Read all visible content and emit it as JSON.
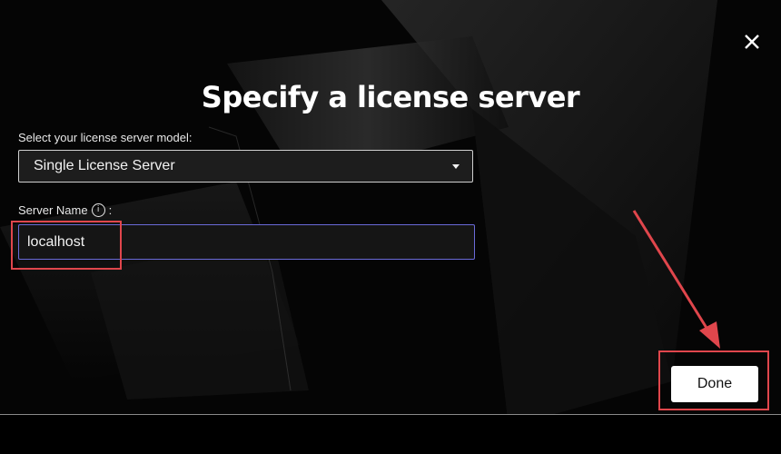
{
  "dialog": {
    "title": "Specify a license server",
    "close_icon": "close-icon"
  },
  "form": {
    "model_label": "Select your license server model:",
    "model_selected": "Single License Server",
    "server_name_label": "Server Name",
    "server_name_suffix": ":",
    "info_icon_glyph": "i",
    "server_name_value": "localhost"
  },
  "actions": {
    "done_label": "Done"
  },
  "colors": {
    "highlight": "#e0464c",
    "input_focus_border": "#6a6ad8",
    "button_bg": "#ffffff"
  }
}
